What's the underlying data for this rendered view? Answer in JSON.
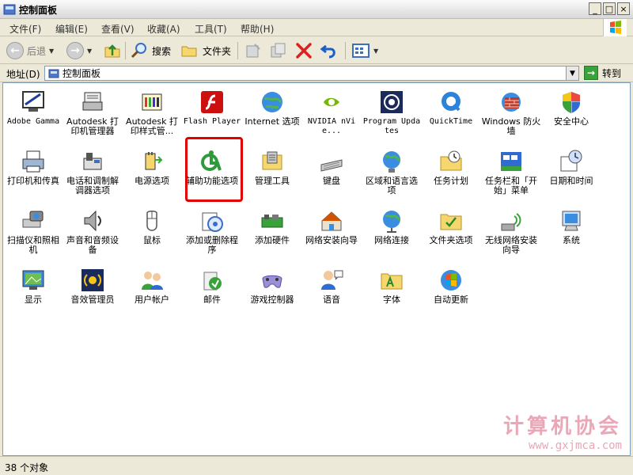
{
  "window": {
    "title": "控制面板"
  },
  "menu": [
    "文件(F)",
    "编辑(E)",
    "查看(V)",
    "收藏(A)",
    "工具(T)",
    "帮助(H)"
  ],
  "toolbar": {
    "back": "后退",
    "search": "搜索",
    "folders": "文件夹"
  },
  "address": {
    "label": "地址(D)",
    "value": "控制面板",
    "go": "转到"
  },
  "items": [
    {
      "label": "Adobe Gamma",
      "icon": "monitor-icon"
    },
    {
      "label": "Autodesk 打印机管理器",
      "icon": "printer-manager-icon"
    },
    {
      "label": "Autodesk 打印样式管...",
      "icon": "print-style-icon"
    },
    {
      "label": "Flash Player",
      "icon": "flash-icon"
    },
    {
      "label": "Internet 选项",
      "icon": "globe-icon"
    },
    {
      "label": "NVIDIA nVie...",
      "icon": "nvidia-icon"
    },
    {
      "label": "Program Updates",
      "icon": "updates-icon"
    },
    {
      "label": "QuickTime",
      "icon": "quicktime-icon"
    },
    {
      "label": "Windows 防火墙",
      "icon": "firewall-icon"
    },
    {
      "label": "安全中心",
      "icon": "security-shield-icon"
    },
    {
      "label": "打印机和传真",
      "icon": "printer-icon"
    },
    {
      "label": "电话和调制解调器选项",
      "icon": "phone-icon"
    },
    {
      "label": "电源选项",
      "icon": "power-icon"
    },
    {
      "label": "辅助功能选项",
      "icon": "accessibility-icon"
    },
    {
      "label": "管理工具",
      "icon": "admin-tools-icon"
    },
    {
      "label": "键盘",
      "icon": "keyboard-icon"
    },
    {
      "label": "区域和语言选项",
      "icon": "region-globe-icon"
    },
    {
      "label": "任务计划",
      "icon": "scheduled-tasks-icon"
    },
    {
      "label": "任务栏和「开始」菜单",
      "icon": "taskbar-icon"
    },
    {
      "label": "日期和时间",
      "icon": "clock-icon"
    },
    {
      "label": "扫描仪和照相机",
      "icon": "scanner-icon"
    },
    {
      "label": "声音和音频设备",
      "icon": "speaker-icon"
    },
    {
      "label": "鼠标",
      "icon": "mouse-icon"
    },
    {
      "label": "添加或删除程序",
      "icon": "add-remove-icon"
    },
    {
      "label": "添加硬件",
      "icon": "hardware-icon"
    },
    {
      "label": "网络安装向导",
      "icon": "network-wizard-icon"
    },
    {
      "label": "网络连接",
      "icon": "network-icon"
    },
    {
      "label": "文件夹选项",
      "icon": "folder-options-icon"
    },
    {
      "label": "无线网络安装向导",
      "icon": "wireless-icon"
    },
    {
      "label": "系统",
      "icon": "system-icon"
    },
    {
      "label": "显示",
      "icon": "display-icon"
    },
    {
      "label": "音效管理员",
      "icon": "audio-manager-icon"
    },
    {
      "label": "用户帐户",
      "icon": "users-icon"
    },
    {
      "label": "邮件",
      "icon": "mail-icon"
    },
    {
      "label": "游戏控制器",
      "icon": "gamepad-icon"
    },
    {
      "label": "语音",
      "icon": "speech-icon"
    },
    {
      "label": "字体",
      "icon": "fonts-icon"
    },
    {
      "label": "自动更新",
      "icon": "windows-update-icon"
    }
  ],
  "status": {
    "text": "38 个对象"
  },
  "watermark": {
    "title": "计算机协会",
    "url": "www.gxjmca.com"
  }
}
